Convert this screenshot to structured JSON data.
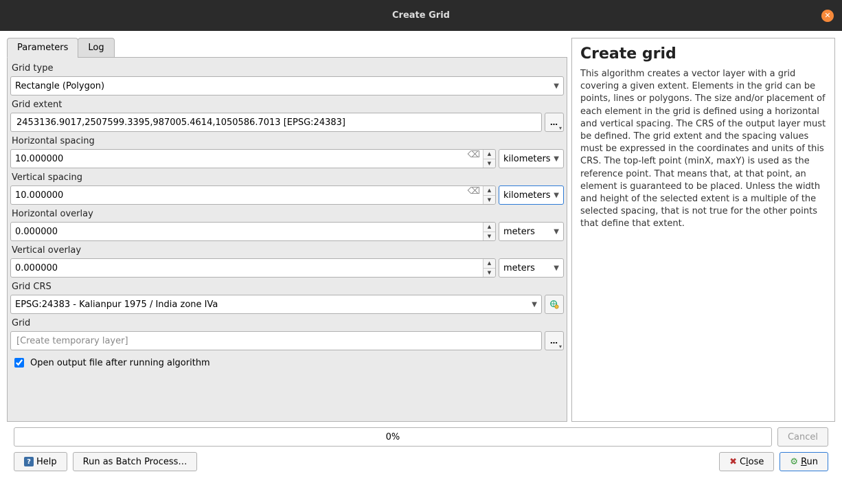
{
  "window": {
    "title": "Create Grid"
  },
  "tabs": {
    "parameters": "Parameters",
    "log": "Log"
  },
  "labels": {
    "grid_type": "Grid type",
    "grid_extent": "Grid extent",
    "hspacing": "Horizontal spacing",
    "vspacing": "Vertical spacing",
    "hoverlay": "Horizontal overlay",
    "voverlay": "Vertical overlay",
    "grid_crs": "Grid CRS",
    "grid_output": "Grid",
    "open_output": "Open output file after running algorithm"
  },
  "values": {
    "grid_type": "Rectangle (Polygon)",
    "grid_extent": "2453136.9017,2507599.3395,987005.4614,1050586.7013 [EPSG:24383]",
    "hspacing": "10.000000",
    "hspacing_unit": "kilometers",
    "vspacing": "10.000000",
    "vspacing_unit": "kilometers",
    "hoverlay": "0.000000",
    "hoverlay_unit": "meters",
    "voverlay": "0.000000",
    "voverlay_unit": "meters",
    "grid_crs": "EPSG:24383 - Kalianpur 1975 / India zone IVa",
    "grid_output_placeholder": "[Create temporary layer]",
    "open_output_checked": true
  },
  "help": {
    "heading": "Create grid",
    "body": "This algorithm creates a vector layer with a grid covering a given extent. Elements in the grid can be points, lines or polygons. The size and/or placement of each element in the grid is defined using a horizontal and vertical spacing. The CRS of the output layer must be defined. The grid extent and the spacing values must be expressed in the coordinates and units of this CRS. The top-left point (minX, maxY) is used as the reference point. That means that, at that point, an element is guaranteed to be placed. Unless the width and height of the selected extent is a multiple of the selected spacing, that is not true for the other points that define that extent."
  },
  "progress": {
    "text": "0%"
  },
  "buttons": {
    "cancel": "Cancel",
    "help": "Help",
    "batch": "Run as Batch Process…",
    "close_pre": "C",
    "close_m": "l",
    "close_post": "ose",
    "run_pre": "",
    "run_m": "R",
    "run_post": "un"
  }
}
